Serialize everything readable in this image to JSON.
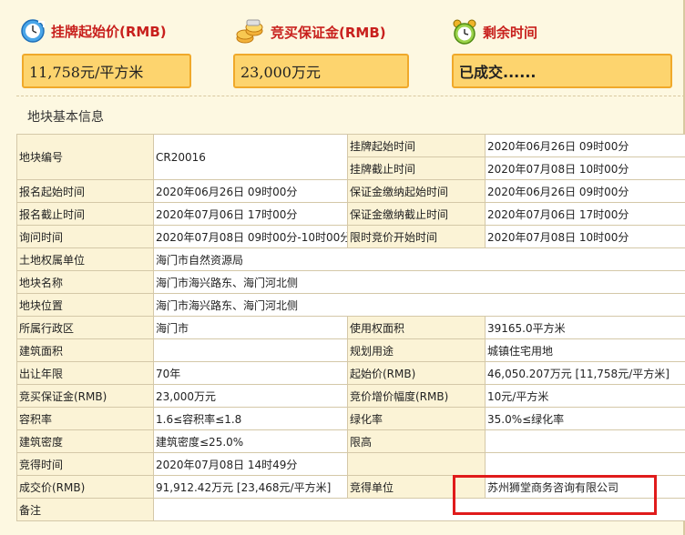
{
  "header": {
    "start_price_label": "挂牌起始价(RMB)",
    "start_price_value": "11,758元/平方米",
    "deposit_label": "竞买保证金(RMB)",
    "deposit_value": "23,000万元",
    "remaining_label": "剩余时间",
    "remaining_value": "已成交......"
  },
  "section_title": "地块基本信息",
  "rows": {
    "r1": {
      "k1": "地块编号",
      "v1": "CR20016",
      "k2": "挂牌起始时间",
      "v2": "2020年06月26日 09时00分"
    },
    "r2": {
      "k2": "挂牌截止时间",
      "v2": "2020年07月08日 10时00分"
    },
    "r3": {
      "k1": "报名起始时间",
      "v1": "2020年06月26日 09时00分",
      "k2": "保证金缴纳起始时间",
      "v2": "2020年06月26日 09时00分"
    },
    "r4": {
      "k1": "报名截止时间",
      "v1": "2020年07月06日 17时00分",
      "k2": "保证金缴纳截止时间",
      "v2": "2020年07月06日 17时00分"
    },
    "r5": {
      "k1": "询问时间",
      "v1": "2020年07月08日 09时00分-10时00分",
      "k2": "限时竞价开始时间",
      "v2": "2020年07月08日 10时00分"
    },
    "r6": {
      "k1": "土地权属单位",
      "v1": "海门市自然资源局"
    },
    "r7": {
      "k1": "地块名称",
      "v1": "海门市海兴路东、海门河北侧"
    },
    "r8": {
      "k1": "地块位置",
      "v1": "海门市海兴路东、海门河北侧"
    },
    "r9": {
      "k1": "所属行政区",
      "v1": "海门市",
      "k2": "使用权面积",
      "v2": "39165.0平方米"
    },
    "r10": {
      "k1": "建筑面积",
      "v1": "",
      "k2": "规划用途",
      "v2": "城镇住宅用地"
    },
    "r11": {
      "k1": "出让年限",
      "v1": "70年",
      "k2": "起始价(RMB)",
      "v2": "46,050.207万元 [11,758元/平方米]"
    },
    "r12": {
      "k1": "竞买保证金(RMB)",
      "v1": "23,000万元",
      "k2": "竞价增价幅度(RMB)",
      "v2": "10元/平方米"
    },
    "r13": {
      "k1": "容积率",
      "v1": "1.6≤容积率≤1.8",
      "k2": "绿化率",
      "v2": "35.0%≤绿化率"
    },
    "r14": {
      "k1": "建筑密度",
      "v1": "建筑密度≤25.0%",
      "k2": "限高",
      "v2": ""
    },
    "r15": {
      "k1": "竞得时间",
      "v1": "2020年07月08日 14时49分",
      "k2": "",
      "v2": ""
    },
    "r16": {
      "k1": "成交价(RMB)",
      "v1": "91,912.42万元 [23,468元/平方米]",
      "k2": "竞得单位",
      "v2": "苏州狮堂商务咨询有限公司"
    },
    "r17": {
      "k1": "备注",
      "v1": ""
    }
  },
  "colors": {
    "header_label": "#c8201d",
    "value_box_fill": "#fdd46e",
    "value_box_border": "#f0a92a",
    "highlight_border": "#e01b1b",
    "page_bg": "#fdf8e1"
  },
  "icons": [
    "clock-arrow-icon",
    "coins-icon",
    "alarm-clock-icon"
  ]
}
